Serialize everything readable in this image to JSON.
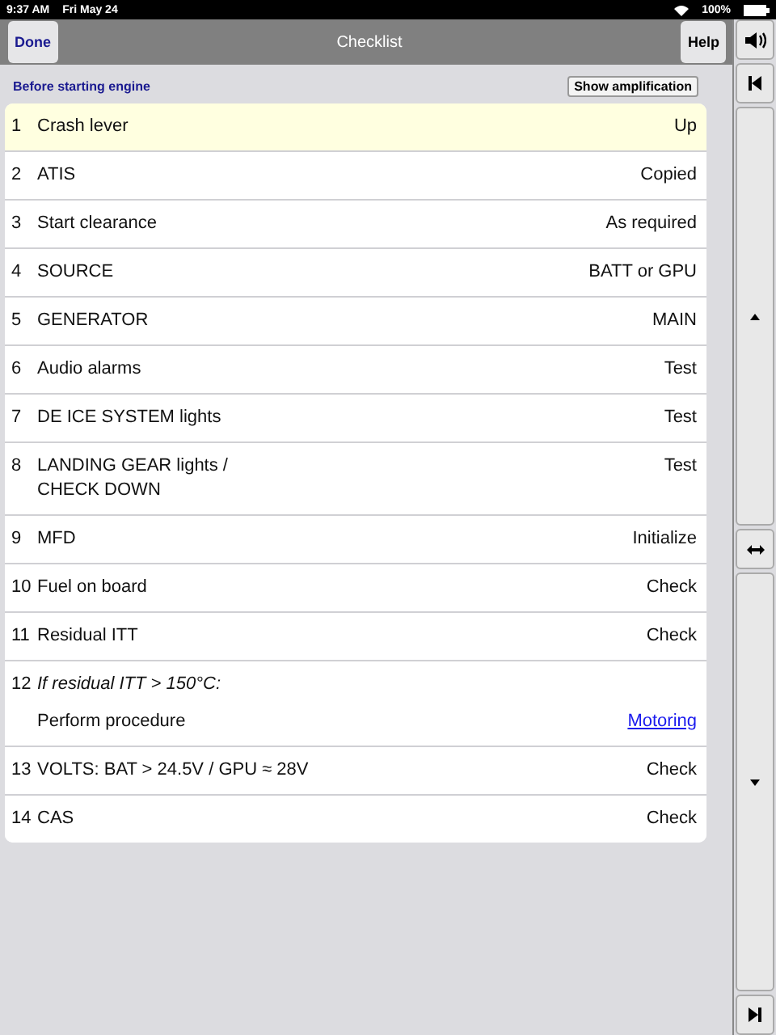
{
  "status_bar": {
    "time": "9:37 AM",
    "date": "Fri May 24",
    "battery": "100%"
  },
  "nav": {
    "left_button": "Done",
    "title": "Checklist",
    "right_button": "Help"
  },
  "section": {
    "title": "Before starting engine",
    "button": "Show amplification"
  },
  "items": [
    {
      "kind": "item",
      "number": "1",
      "action": "Crash lever",
      "value": "Up",
      "selected": true
    },
    {
      "kind": "item",
      "number": "2",
      "action": "ATIS",
      "value": "Copied",
      "selected": false
    },
    {
      "kind": "item",
      "number": "3",
      "action": "Start clearance",
      "value": "As required",
      "selected": false
    },
    {
      "kind": "item",
      "number": "4",
      "action": "SOURCE",
      "value": "BATT or GPU",
      "selected": false
    },
    {
      "kind": "item",
      "number": "5",
      "action": "GENERATOR",
      "value": "MAIN",
      "selected": false
    },
    {
      "kind": "item",
      "number": "6",
      "action": "Audio alarms",
      "value": "Test",
      "selected": false
    },
    {
      "kind": "item",
      "number": "7",
      "action": "DE ICE SYSTEM lights",
      "value": "Test",
      "selected": false
    },
    {
      "kind": "item",
      "number": "8",
      "action": "LANDING GEAR lights /\nCHECK DOWN",
      "value": "Test",
      "selected": false
    },
    {
      "kind": "item",
      "number": "9",
      "action": "MFD",
      "value": "Initialize",
      "selected": false
    },
    {
      "kind": "item",
      "number": "10",
      "action": "Fuel on board",
      "value": "Check",
      "selected": false
    },
    {
      "kind": "item",
      "number": "11",
      "action": "Residual ITT",
      "value": "Check",
      "selected": false
    },
    {
      "kind": "condition",
      "number": "12",
      "condition": "If residual ITT > 150°C:",
      "action": "Perform procedure",
      "link": "Motoring",
      "selected": false
    },
    {
      "kind": "item",
      "number": "13",
      "action": "VOLTS: BAT > 24.5V / GPU ≈ 28V",
      "value": "Check",
      "selected": false
    },
    {
      "kind": "item",
      "number": "14",
      "action": "CAS",
      "value": "Check",
      "selected": false
    }
  ]
}
